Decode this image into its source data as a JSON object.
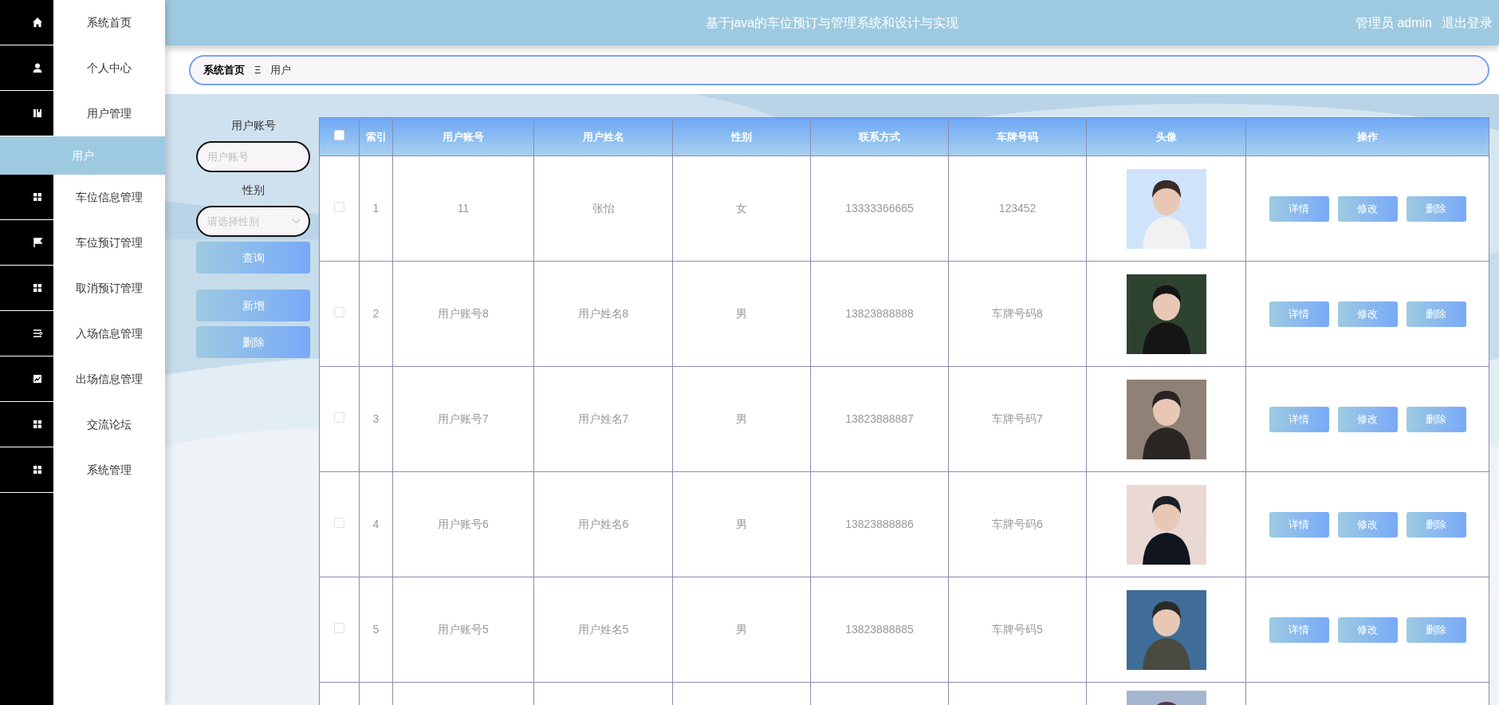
{
  "sidebar": {
    "items": [
      {
        "label": "系统首页",
        "selected": false
      },
      {
        "label": "个人中心",
        "selected": false
      },
      {
        "label": "用户管理",
        "selected": false,
        "expanded": true,
        "children": [
          {
            "label": "用户",
            "selected": true
          }
        ]
      },
      {
        "label": "车位信息管理",
        "selected": false
      },
      {
        "label": "车位预订管理",
        "selected": false
      },
      {
        "label": "取消预订管理",
        "selected": false
      },
      {
        "label": "入场信息管理",
        "selected": false
      },
      {
        "label": "出场信息管理",
        "selected": false
      },
      {
        "label": "交流论坛",
        "selected": false
      },
      {
        "label": "系统管理",
        "selected": false
      }
    ]
  },
  "header": {
    "title": "基于java的车位预订与管理系统和设计与实现",
    "user": "管理员 admin",
    "logout": "退出登录"
  },
  "breadcrumb": {
    "items": [
      "系统首页",
      "用户"
    ],
    "separator": "Ξ"
  },
  "search": {
    "fields": [
      {
        "kind": "input",
        "label": "用户账号",
        "placeholder": "用户账号"
      },
      {
        "kind": "select",
        "label": "性别",
        "placeholder": "请选择性别"
      }
    ],
    "query_button": "查询",
    "actions": [
      "新增",
      "删除"
    ]
  },
  "table": {
    "select_all": {
      "checked": false
    },
    "columns": [
      "索引",
      "用户账号",
      "用户姓名",
      "性别",
      "联系方式",
      "车牌号码",
      "头像",
      "操作"
    ],
    "rows": [
      {
        "selected": false,
        "index": "1",
        "account": "11",
        "name": "张怡",
        "gender": "女",
        "phone": "13333366665",
        "plate": "123452",
        "actions": [
          "详情",
          "修改",
          "删除"
        ]
      },
      {
        "selected": false,
        "index": "2",
        "account": "用户账号8",
        "name": "用户姓名8",
        "gender": "男",
        "phone": "13823888888",
        "plate": "车牌号码8",
        "actions": [
          "详情",
          "修改",
          "删除"
        ]
      },
      {
        "selected": false,
        "index": "3",
        "account": "用户账号7",
        "name": "用户姓名7",
        "gender": "男",
        "phone": "13823888887",
        "plate": "车牌号码7",
        "actions": [
          "详情",
          "修改",
          "删除"
        ]
      },
      {
        "selected": false,
        "index": "4",
        "account": "用户账号6",
        "name": "用户姓名6",
        "gender": "男",
        "phone": "13823888886",
        "plate": "车牌号码6",
        "actions": [
          "详情",
          "修改",
          "删除"
        ]
      },
      {
        "selected": false,
        "index": "5",
        "account": "用户账号5",
        "name": "用户姓名5",
        "gender": "男",
        "phone": "13823888885",
        "plate": "车牌号码5",
        "actions": [
          "详情",
          "修改",
          "删除"
        ]
      }
    ]
  }
}
